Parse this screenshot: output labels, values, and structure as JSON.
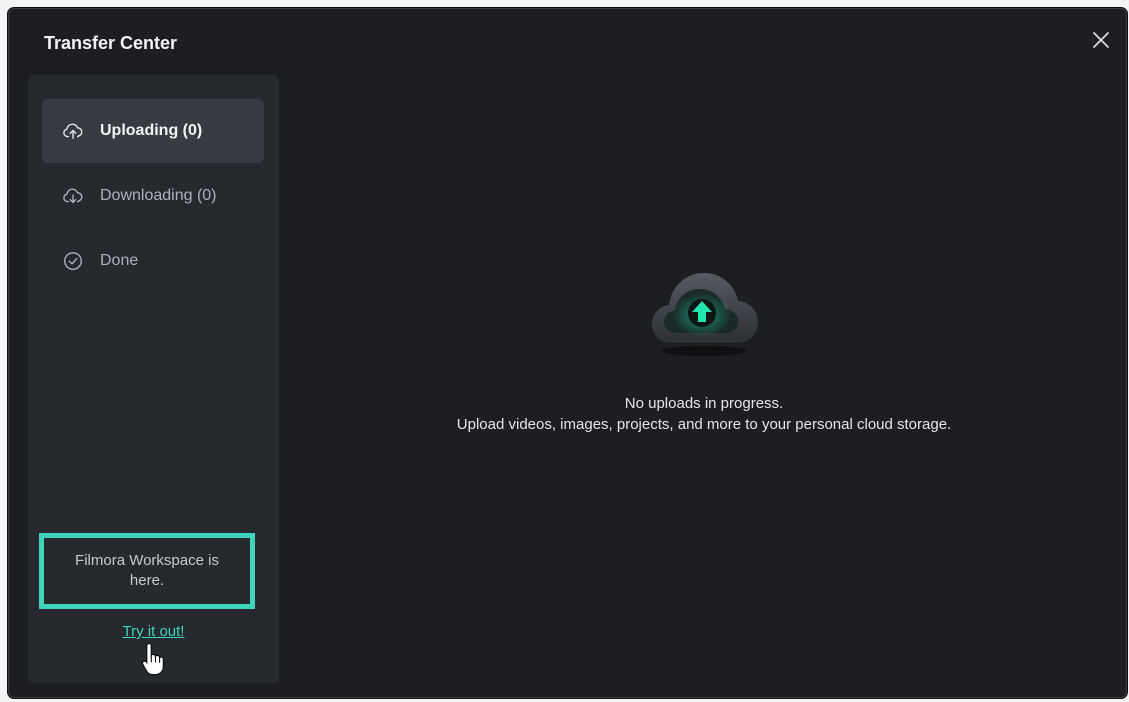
{
  "dialog": {
    "title": "Transfer Center",
    "close_icon": "close-icon"
  },
  "sidebar": {
    "items": [
      {
        "label": "Uploading (0)",
        "icon": "cloud-upload-icon",
        "active": true
      },
      {
        "label": "Downloading (0)",
        "icon": "cloud-download-icon",
        "active": false
      },
      {
        "label": "Done",
        "icon": "check-circle-icon",
        "active": false
      }
    ],
    "promo": {
      "text": "Filmora Workspace is here.",
      "link_label": "Try it out!"
    }
  },
  "main": {
    "empty_icon": "cloud-upload-illustration",
    "empty_title": "No uploads in progress.",
    "empty_subtitle": "Upload videos, images, projects, and more to your personal cloud storage."
  },
  "colors": {
    "background": "#1c1e21",
    "sidebar": "#26292d",
    "active_item": "#383c42",
    "accent": "#3fd4bb"
  }
}
